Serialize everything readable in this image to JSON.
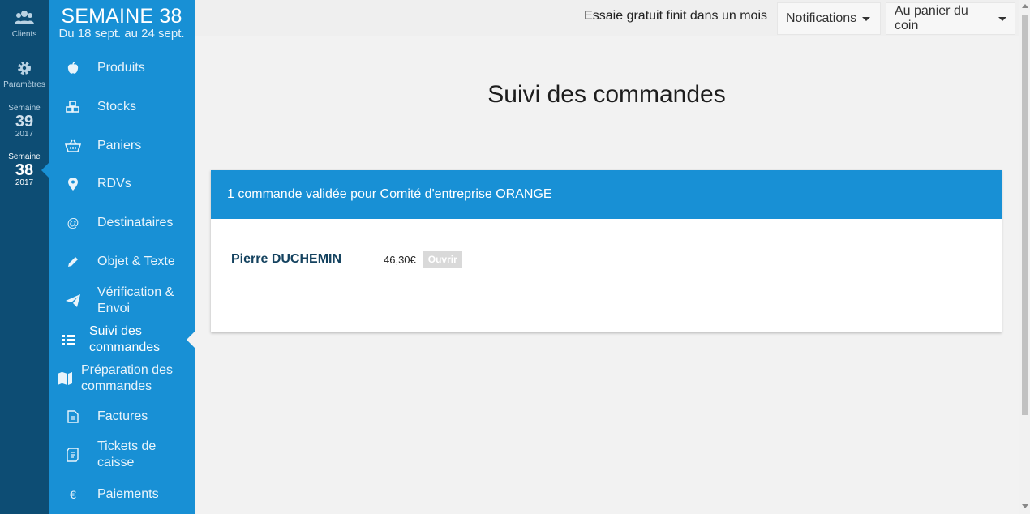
{
  "rail": {
    "clients_label": "Clients",
    "params_label": "Paramètres",
    "weeks": [
      {
        "label": "Semaine",
        "number": "39",
        "year": "2017"
      },
      {
        "label": "Semaine",
        "number": "38",
        "year": "2017"
      }
    ]
  },
  "sidebar": {
    "week_title": "SEMAINE 38",
    "week_range": "Du 18 sept. au 24 sept.",
    "items": [
      {
        "icon": "apple-icon",
        "label": "Produits"
      },
      {
        "icon": "cubes-icon",
        "label": "Stocks"
      },
      {
        "icon": "basket-icon",
        "label": "Paniers"
      },
      {
        "icon": "map-marker-icon",
        "label": "RDVs"
      },
      {
        "icon": "at-icon",
        "label": "Destinataires"
      },
      {
        "icon": "pencil-icon",
        "label": "Objet & Texte"
      },
      {
        "icon": "paper-plane-icon",
        "label": "Vérification & Envoi"
      },
      {
        "icon": "list-icon",
        "label": "Suivi des commandes"
      },
      {
        "icon": "map-icon",
        "label": "Préparation des commandes"
      },
      {
        "icon": "file-icon",
        "label": "Factures"
      },
      {
        "icon": "receipt-icon",
        "label": "Tickets de caisse"
      },
      {
        "icon": "euro-icon",
        "label": "Paiements"
      }
    ]
  },
  "topbar": {
    "trial_text": "Essaie gratuit finit dans un mois",
    "notifications_label": "Notifications",
    "shop_label": "Au panier du coin"
  },
  "main": {
    "title": "Suivi des commandes",
    "card_header": "1 commande validée pour Comité d'entreprise ORANGE",
    "orders": [
      {
        "customer": "Pierre DUCHEMIN",
        "amount": "46,30€",
        "action": "Ouvrir"
      }
    ]
  },
  "colors": {
    "rail": "#0d4d74",
    "sidebar": "#1890d5",
    "accent": "#1890d5",
    "customer_name": "#14425f"
  }
}
